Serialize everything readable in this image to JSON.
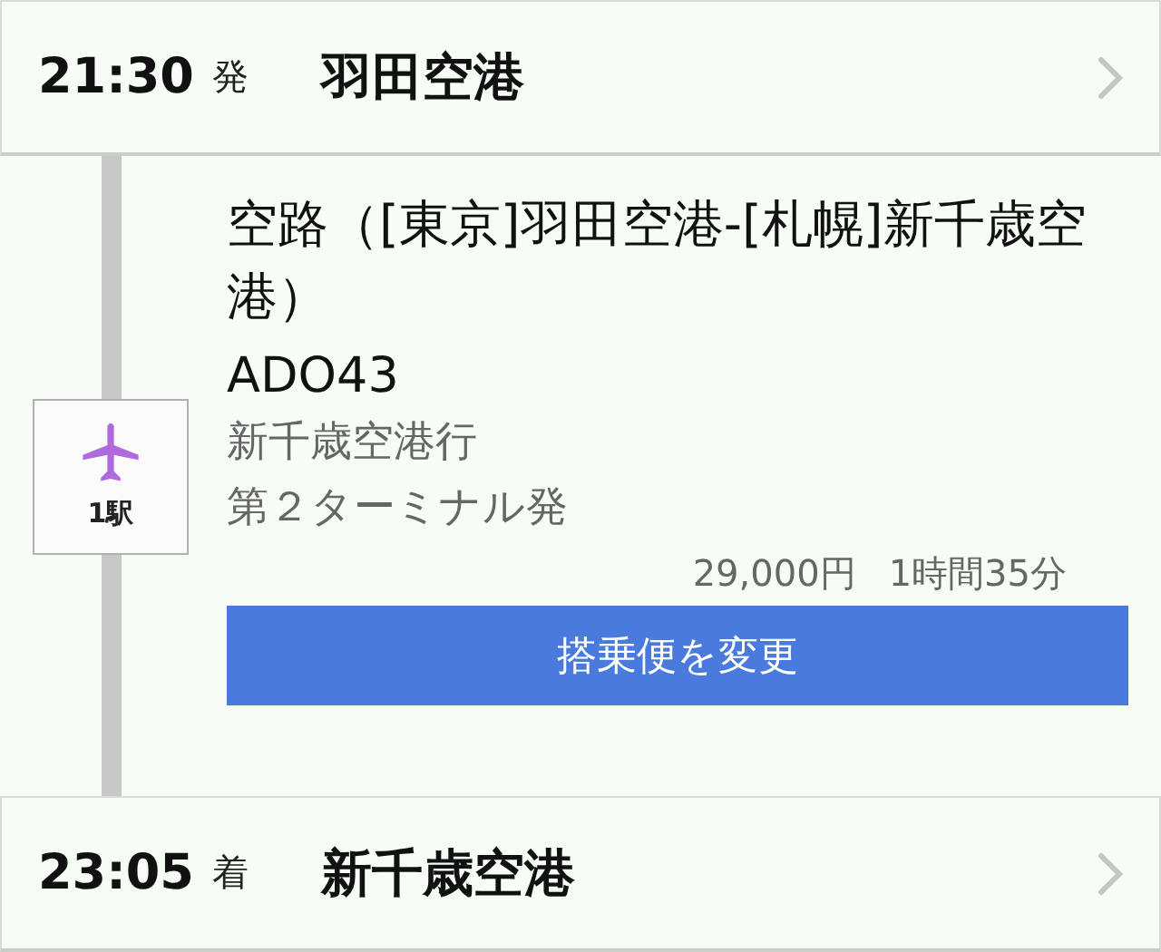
{
  "departure": {
    "time": "21:30",
    "mark": "発",
    "station": "羽田空港"
  },
  "segment": {
    "route": "空路（[東京]羽田空港-[札幌]新千歳空港）",
    "flight": "ADO43",
    "destination": "新千歳空港行",
    "terminal": "第２ターミナル発",
    "fare": "29,000円",
    "duration": "1時間35分",
    "stops": "1駅",
    "button": "搭乗便を変更"
  },
  "arrival": {
    "time": "23:05",
    "mark": "着",
    "station": "新千歳空港"
  }
}
